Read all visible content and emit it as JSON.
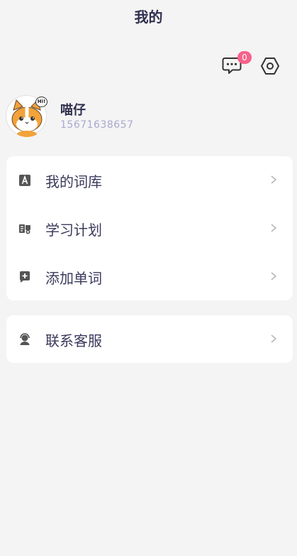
{
  "header": {
    "title": "我的"
  },
  "notifications": {
    "badge_count": "0",
    "icon": "chat-bubble-dots-icon"
  },
  "settings": {
    "icon": "hexagon-settings-icon"
  },
  "profile": {
    "name": "喵仔",
    "phone": "15671638657",
    "avatar_bubble": "Hi!"
  },
  "menu": {
    "items": [
      {
        "label": "我的词库",
        "icon": "vocabulary-icon"
      },
      {
        "label": "学习计划",
        "icon": "study-plan-icon"
      },
      {
        "label": "添加单词",
        "icon": "add-word-icon"
      }
    ],
    "support": {
      "label": "联系客服",
      "icon": "customer-service-icon"
    }
  },
  "colors": {
    "background": "#f4f4f4",
    "card": "#ffffff",
    "text": "#3a3a5c",
    "phone": "#a8a9cf",
    "badge": "#f7618a"
  }
}
